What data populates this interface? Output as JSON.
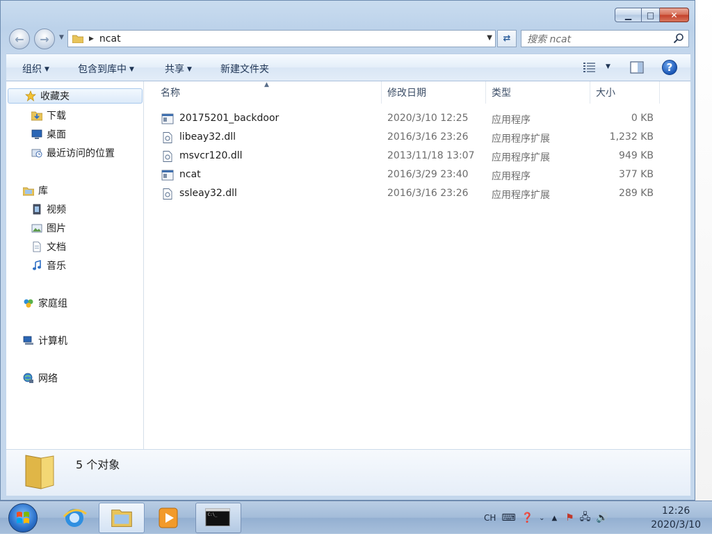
{
  "window": {
    "buttons": {
      "minimize": "▁",
      "maximize": "□",
      "close": "✕"
    }
  },
  "address": {
    "path": "ncat",
    "search_placeholder": "搜索 ncat"
  },
  "toolbar": {
    "organize": "组织",
    "include_in_library": "包含到库中",
    "share": "共享",
    "new_folder": "新建文件夹"
  },
  "nav": {
    "favorites": "收藏夹",
    "downloads": "下载",
    "desktop": "桌面",
    "recent": "最近访问的位置",
    "libraries": "库",
    "videos": "视频",
    "pictures": "图片",
    "documents": "文档",
    "music": "音乐",
    "homegroup": "家庭组",
    "computer": "计算机",
    "network": "网络"
  },
  "columns": {
    "name": "名称",
    "date": "修改日期",
    "type": "类型",
    "size": "大小"
  },
  "files": [
    {
      "name": "20175201_backdoor",
      "date": "2020/3/10 12:25",
      "type": "应用程序",
      "size": "0 KB",
      "icon": "exe"
    },
    {
      "name": "libeay32.dll",
      "date": "2016/3/16 23:26",
      "type": "应用程序扩展",
      "size": "1,232 KB",
      "icon": "dll"
    },
    {
      "name": "msvcr120.dll",
      "date": "2013/11/18 13:07",
      "type": "应用程序扩展",
      "size": "949 KB",
      "icon": "dll"
    },
    {
      "name": "ncat",
      "date": "2016/3/29 23:40",
      "type": "应用程序",
      "size": "377 KB",
      "icon": "exe"
    },
    {
      "name": "ssleay32.dll",
      "date": "2016/3/16 23:26",
      "type": "应用程序扩展",
      "size": "289 KB",
      "icon": "dll"
    }
  ],
  "details": {
    "count": "5 个对象"
  },
  "taskbar": {
    "lang": "CH",
    "time": "12:26",
    "date": "2020/3/10"
  }
}
